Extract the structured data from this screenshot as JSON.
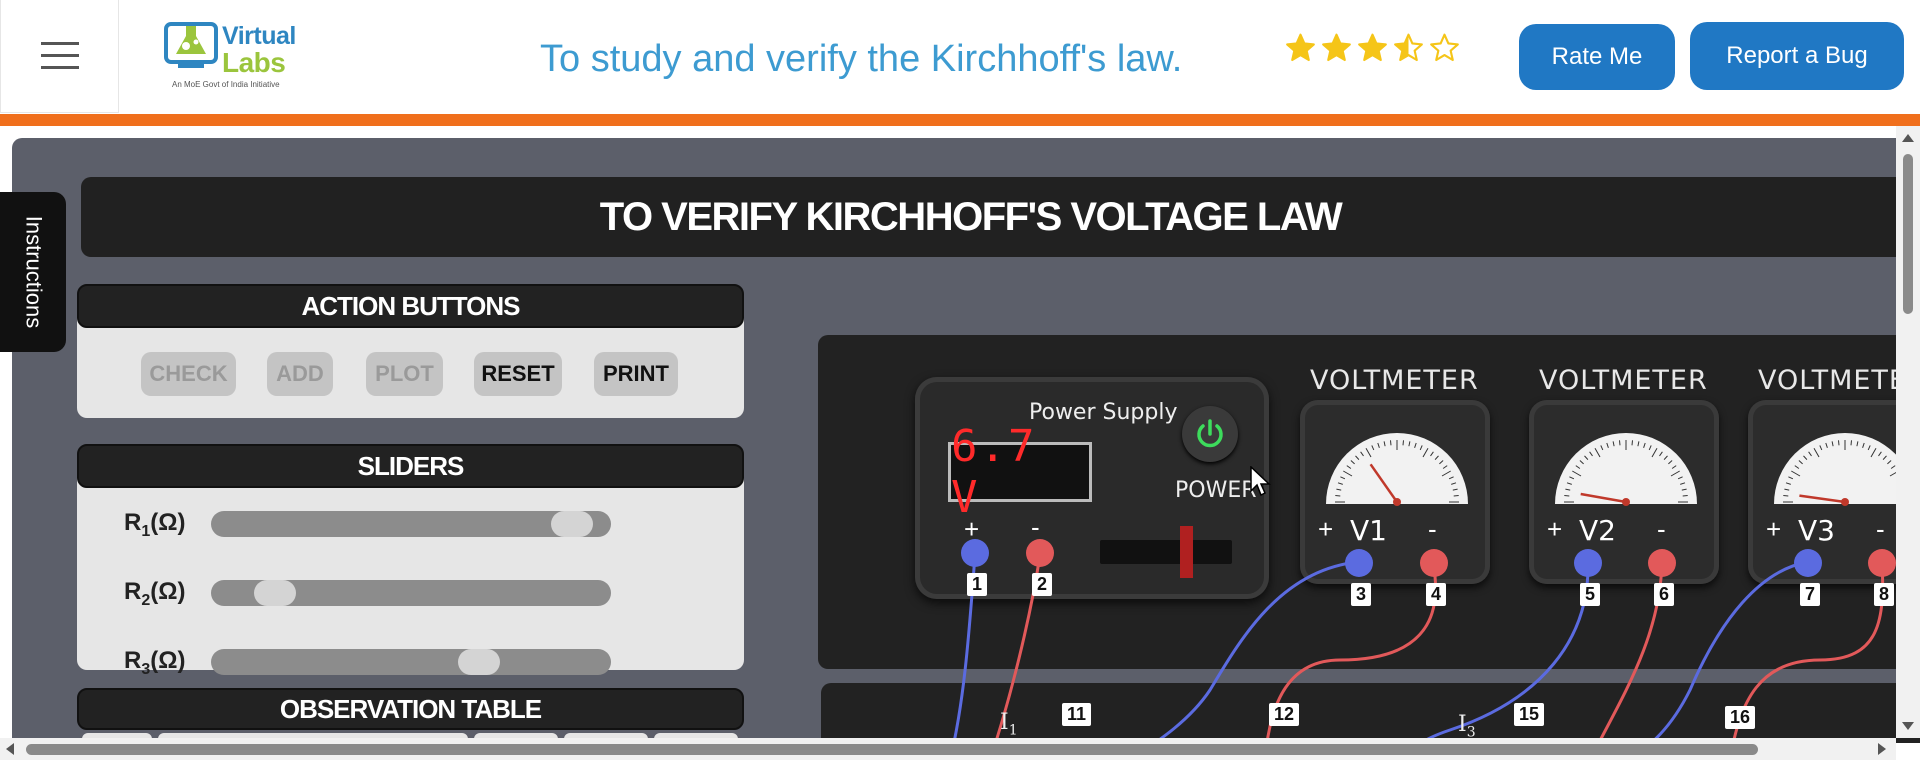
{
  "header": {
    "logo": {
      "line1": "Virtual",
      "line2": "Labs",
      "tagline": "An MoE Govt of India Initiative"
    },
    "title": "To study and verify the Kirchhoff's law.",
    "rating": 3.5,
    "rating_max": 5,
    "rate_button": "Rate Me",
    "bug_button": "Report a Bug"
  },
  "sidebar_tab": "Instructions",
  "sim": {
    "title": "TO VERIFY KIRCHHOFF'S VOLTAGE LAW",
    "action_panel": {
      "heading": "ACTION BUTTONS",
      "buttons": [
        {
          "label": "CHECK",
          "enabled": false
        },
        {
          "label": "ADD",
          "enabled": false
        },
        {
          "label": "PLOT",
          "enabled": false
        },
        {
          "label": "RESET",
          "enabled": true
        },
        {
          "label": "PRINT",
          "enabled": true
        }
      ]
    },
    "sliders_panel": {
      "heading": "SLIDERS",
      "sliders": [
        {
          "label": "R",
          "sub": "1",
          "unit": "(Ω)",
          "level": 0.95
        },
        {
          "label": "R",
          "sub": "2",
          "unit": "(Ω)",
          "level": 0.12
        },
        {
          "label": "R",
          "sub": "3",
          "unit": "(Ω)",
          "level": 0.69
        }
      ]
    },
    "observation_heading": "OBSERVATION TABLE",
    "power_supply": {
      "title": "Power Supply",
      "display": "6.7 V",
      "power_label": "POWER",
      "plus": "+",
      "minus": "-"
    },
    "voltmeters": [
      {
        "title": "VOLTMETER",
        "name": "V1",
        "plus": "+",
        "minus": "-"
      },
      {
        "title": "VOLTMETER",
        "name": "V2",
        "plus": "+",
        "minus": "-"
      },
      {
        "title": "VOLTMETER",
        "name": "V3",
        "plus": "+",
        "minus": "-"
      }
    ],
    "terminals": [
      "1",
      "2",
      "3",
      "4",
      "5",
      "6",
      "7",
      "8"
    ],
    "lower_nodes": [
      "11",
      "12",
      "15",
      "16"
    ],
    "currents": [
      {
        "label": "I",
        "sub": "1"
      },
      {
        "label": "I",
        "sub": "3"
      }
    ]
  },
  "colors": {
    "accent": "#2078c4",
    "orange_bar": "#f06f1c",
    "title_blue": "#3d9bd1",
    "star": "#f5c518",
    "wire_blue": "#5b6be0",
    "wire_red": "#e2595a",
    "display_red": "#ff2a2a",
    "power_green": "#3ddc5c"
  },
  "icons": [
    "hamburger-menu-icon",
    "virtual-labs-flask-icon",
    "star-icon",
    "power-icon",
    "mouse-cursor-icon"
  ]
}
